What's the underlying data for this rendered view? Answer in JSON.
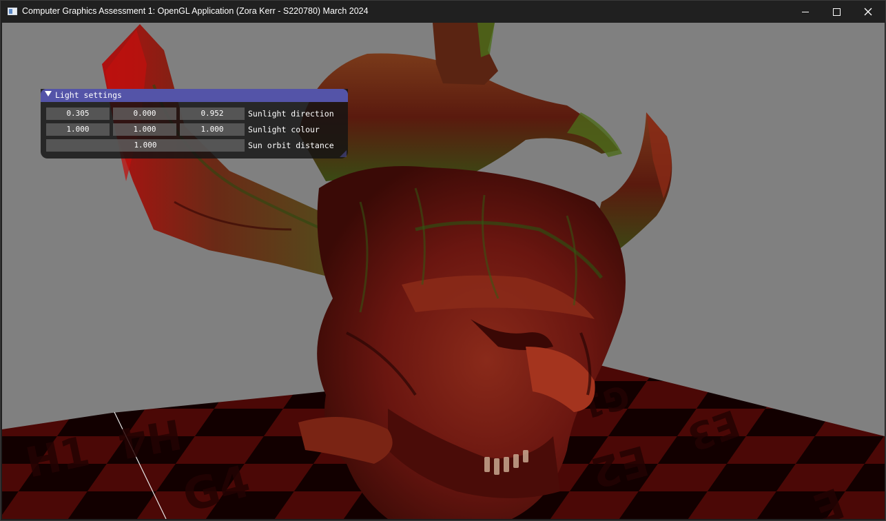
{
  "window": {
    "title": "Computer Graphics Assessment 1: OpenGL Application (Zora Kerr - S220780) March 2024",
    "controls": {
      "minimize_icon": "minimize-icon",
      "maximize_icon": "maximize-icon",
      "close_icon": "close-icon"
    }
  },
  "scene": {
    "background_color": "#808080",
    "model_base_color": "#7a1a12",
    "model_highlight_color": "#3f7a1c",
    "floor_dark_color": "#1a0202",
    "floor_light_color": "#5a0b08",
    "floor_labels": [
      "H1",
      "H4",
      "G4",
      "G1",
      "E3",
      "E2",
      "H",
      "G",
      "E"
    ]
  },
  "light_panel": {
    "title": "Light settings",
    "header_color": "#5454a8",
    "rows": [
      {
        "label": "Sunlight direction",
        "values": [
          "0.305",
          "0.000",
          "0.952"
        ]
      },
      {
        "label": "Sunlight colour",
        "values": [
          "1.000",
          "1.000",
          "1.000"
        ]
      },
      {
        "label": "Sun orbit distance",
        "values": [
          "1.000"
        ]
      }
    ]
  }
}
